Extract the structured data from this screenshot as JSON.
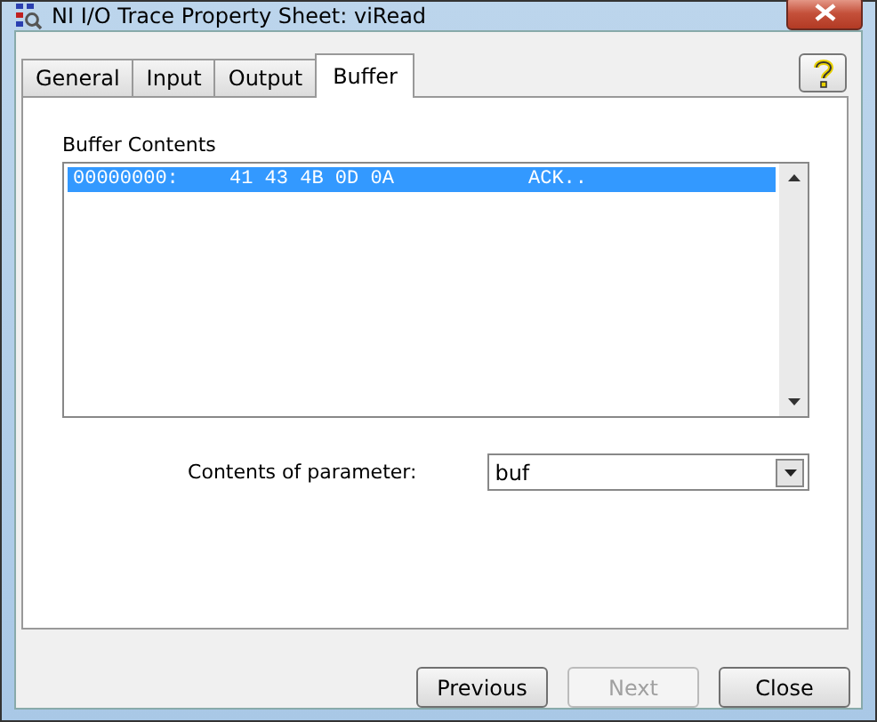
{
  "window": {
    "title": "NI I/O Trace Property Sheet: viRead"
  },
  "tabs": [
    {
      "label": "General",
      "selected": false
    },
    {
      "label": "Input",
      "selected": false
    },
    {
      "label": "Output",
      "selected": false
    },
    {
      "label": "Buffer",
      "selected": true
    }
  ],
  "buffer": {
    "label": "Buffer Contents",
    "rows": [
      {
        "address": "00000000:",
        "bytes": "41 43 4B 0D 0A",
        "ascii": "ACK..",
        "selected": true
      }
    ]
  },
  "parameter": {
    "label": "Contents of parameter:",
    "value": "buf"
  },
  "buttons": [
    {
      "label": "Previous",
      "disabled": false
    },
    {
      "label": "Next",
      "disabled": true
    },
    {
      "label": "Close",
      "disabled": false
    }
  ]
}
